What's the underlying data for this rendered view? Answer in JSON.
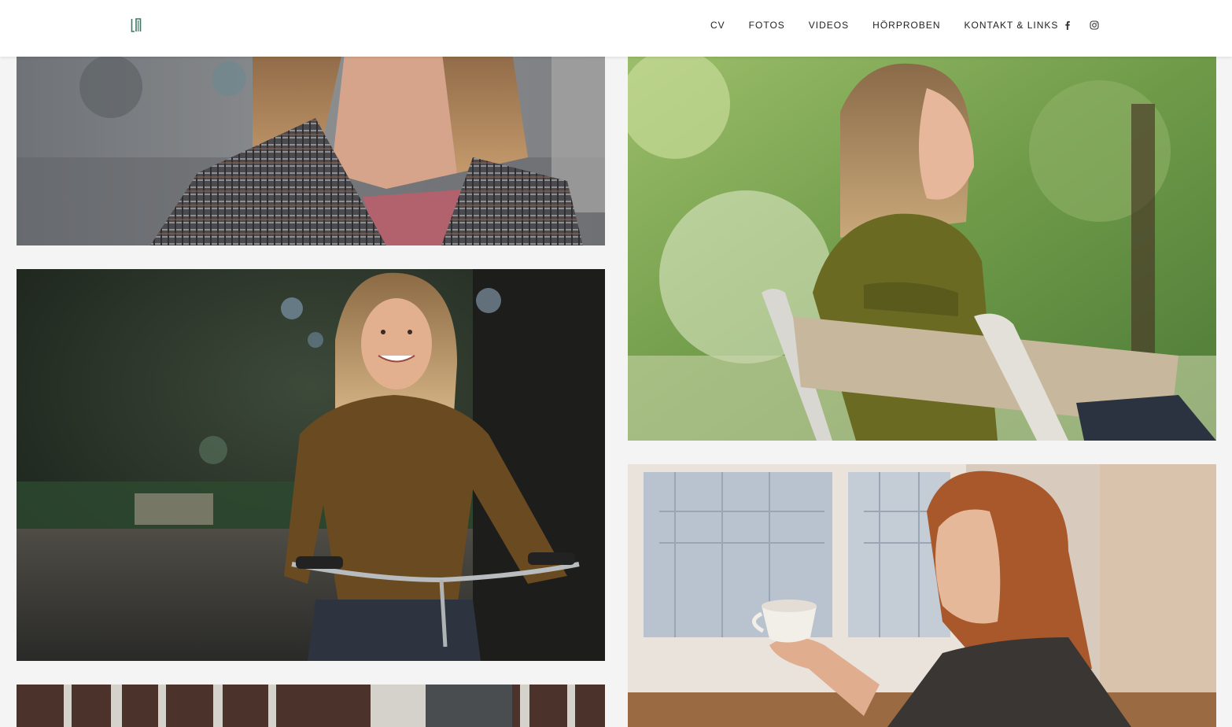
{
  "header": {
    "logo_icon": "logo-monogram-icon",
    "nav": [
      {
        "label": "CV"
      },
      {
        "label": "FOTOS"
      },
      {
        "label": "VIDEOS"
      },
      {
        "label": "HÖRPROBEN"
      },
      {
        "label": "KONTAKT & LINKS"
      }
    ],
    "social": [
      {
        "icon": "facebook-icon"
      },
      {
        "icon": "instagram-icon"
      }
    ]
  },
  "gallery": {
    "photos": [
      {
        "subject": "woman-plaid-coat-street"
      },
      {
        "subject": "woman-on-bicycle-park"
      },
      {
        "subject": "woman-on-bench-park"
      },
      {
        "subject": "woman-coffee-window"
      },
      {
        "subject": "window-bars-partial"
      }
    ]
  },
  "colors": {
    "accent": "#3a7a63",
    "background": "#f4f4f4",
    "header_bg": "#ffffff",
    "nav_text": "#222222"
  }
}
